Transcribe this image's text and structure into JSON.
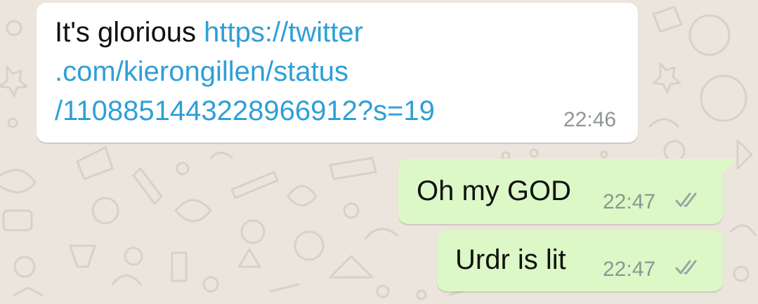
{
  "chat": {
    "messages": [
      {
        "direction": "incoming",
        "prefix": "It's glorious ",
        "link_lines": [
          "https://twitter",
          ".com/kierongillen/status",
          "/1108851443228966912?s=19"
        ],
        "time": "22:46"
      },
      {
        "direction": "outgoing",
        "text": "Oh my GOD",
        "time": "22:47",
        "status_icon": "double-check-icon"
      },
      {
        "direction": "outgoing",
        "text": "Urdr is lit",
        "time": "22:47",
        "status_icon": "double-check-icon"
      }
    ]
  },
  "colors": {
    "wallpaper": "#ece5dd",
    "incoming_bubble": "#ffffff",
    "outgoing_bubble": "#dcf8c6",
    "link": "#2f9fd6",
    "timestamp": "#8f9595",
    "tick": "#9aa5a5"
  }
}
